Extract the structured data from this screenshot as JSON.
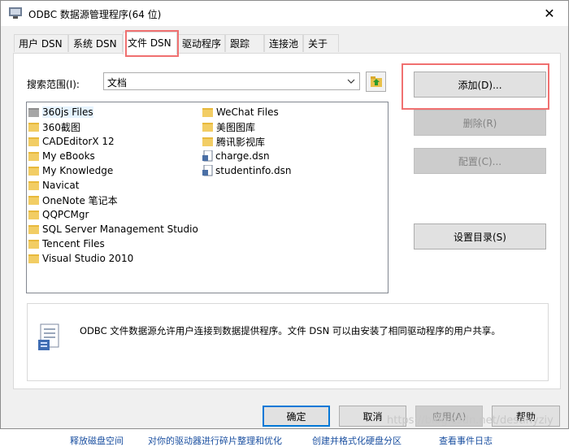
{
  "window": {
    "title": "ODBC 数据源管理程序(64 位)",
    "close_glyph": "✕"
  },
  "tabs": [
    {
      "label": "用户 DSN",
      "active": false
    },
    {
      "label": "系统 DSN",
      "active": false
    },
    {
      "label": "文件 DSN",
      "active": true
    },
    {
      "label": "驱动程序",
      "active": false
    },
    {
      "label": "跟踪",
      "active": false
    },
    {
      "label": "连接池",
      "active": false
    },
    {
      "label": "关于",
      "active": false
    }
  ],
  "lookin": {
    "label": "搜索范围(I):",
    "value": "文档"
  },
  "files": {
    "col1": [
      {
        "name": "360js Files",
        "icon": "folder-icon",
        "selected": true
      },
      {
        "name": "360截图",
        "icon": "folder-icon"
      },
      {
        "name": "CADEditorX 12",
        "icon": "folder-icon"
      },
      {
        "name": "My eBooks",
        "icon": "folder-icon"
      },
      {
        "name": "My Knowledge",
        "icon": "folder-icon"
      },
      {
        "name": "Navicat",
        "icon": "folder-icon"
      },
      {
        "name": "OneNote 笔记本",
        "icon": "folder-icon"
      },
      {
        "name": "QQPCMgr",
        "icon": "folder-icon"
      },
      {
        "name": "SQL Server Management Studio",
        "icon": "folder-icon"
      },
      {
        "name": "Tencent Files",
        "icon": "folder-icon"
      },
      {
        "name": "Visual Studio 2010",
        "icon": "folder-icon"
      }
    ],
    "col2": [
      {
        "name": "WeChat Files",
        "icon": "folder-icon"
      },
      {
        "name": "美图图库",
        "icon": "folder-icon"
      },
      {
        "name": "腾讯影视库",
        "icon": "folder-icon"
      },
      {
        "name": "charge.dsn",
        "icon": "dsn-file-icon"
      },
      {
        "name": "studentinfo.dsn",
        "icon": "dsn-file-icon"
      }
    ]
  },
  "side_buttons": {
    "add": "添加(D)...",
    "remove": "删除(R)",
    "configure": "配置(C)...",
    "set_dir": "设置目录(S)"
  },
  "description": "ODBC 文件数据源允许用户连接到数据提供程序。文件 DSN 可以由安装了相同驱动程序的用户共享。",
  "footer": {
    "ok": "确定",
    "cancel": "取消",
    "apply": "应用(A)",
    "help": "帮助"
  },
  "watermark": "https://blog.csdn.net/destinyziy",
  "background_strip": [
    "释放磁盘空间",
    "对你的驱动器进行碎片整理和优化",
    "创建并格式化硬盘分区",
    "查看事件日志"
  ],
  "colors": {
    "highlight": "#f07070",
    "dialog_bg": "#f0f0f0",
    "folder": "#f2cd64"
  }
}
